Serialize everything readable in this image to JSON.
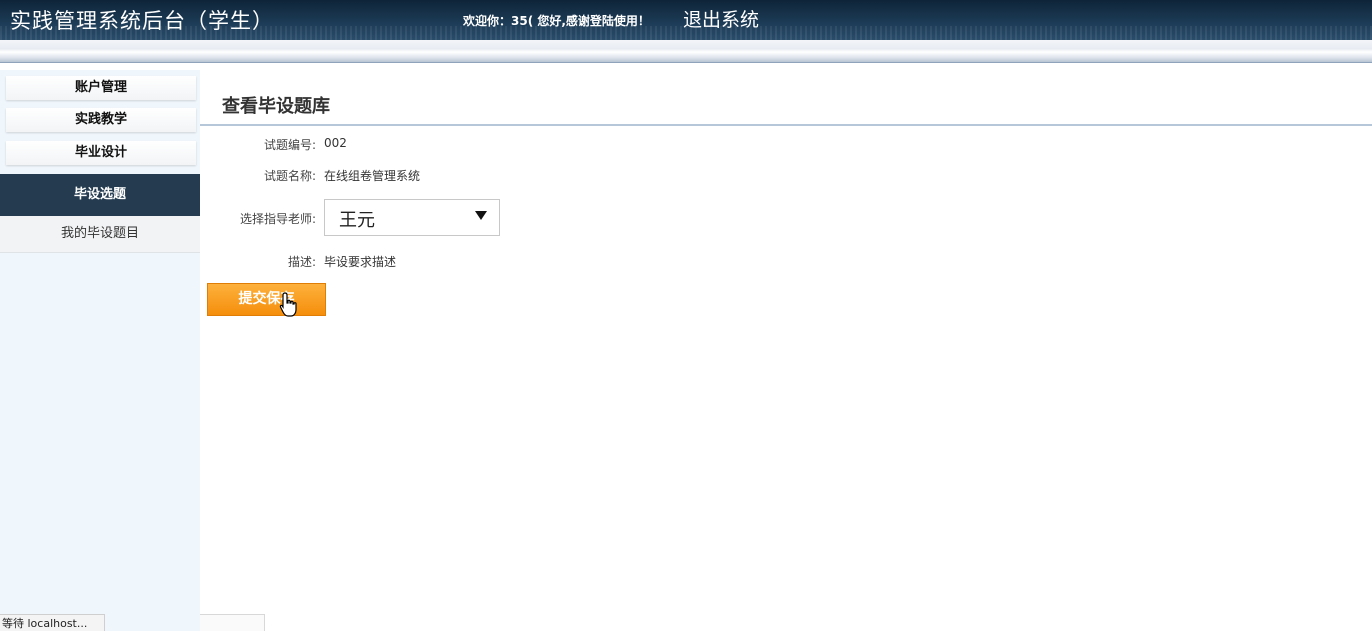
{
  "header": {
    "title": "实践管理系统后台（学生）",
    "welcome": "欢迎你：35( 您好,感谢登陆使用！",
    "logout": "退出系统"
  },
  "sidebar": {
    "items": [
      {
        "label": "账户管理"
      },
      {
        "label": "实践教学"
      },
      {
        "label": "毕业设计"
      }
    ],
    "active": {
      "label": "毕设选题"
    },
    "sub_items": [
      {
        "label": "我的毕设题目"
      }
    ]
  },
  "main": {
    "title": "查看毕设题库",
    "fields": {
      "id_label": "试题编号:",
      "id_value": "002",
      "name_label": "试题名称:",
      "name_value": "在线组卷管理系统",
      "teacher_label": "选择指导老师:",
      "teacher_selected": "王元",
      "desc_label": "描述:",
      "desc_value": "毕设要求描述"
    },
    "submit_label": "提交保存"
  },
  "status_bar": {
    "text": "等待 localhost..."
  },
  "colors": {
    "header_bg": "#1c3a55",
    "sidebar_bg": "#f0f7fc",
    "active_menu": "#243b50",
    "submit_button": "#f7960f"
  }
}
